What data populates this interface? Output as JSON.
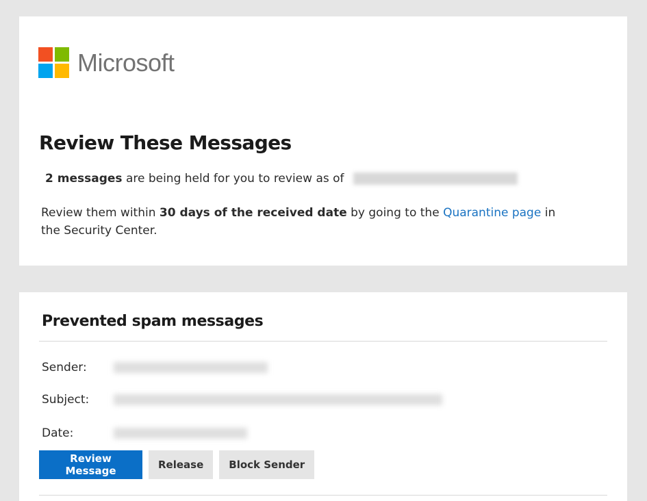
{
  "brand": {
    "name": "Microsoft",
    "logo_colors": [
      "#f25022",
      "#7fba00",
      "#00a4ef",
      "#ffb900"
    ]
  },
  "summary": {
    "title": "Review These Messages",
    "count_text": "2 messages",
    "held_text": "are being held for you to review as of",
    "review_prefix": "Review them within",
    "days_text": "30 days of the received date",
    "going_text": "by going to the",
    "link_text": "Quarantine page",
    "suffix_text": "in the Security Center."
  },
  "spam_section": {
    "title": "Prevented spam messages",
    "sender_label": "Sender:",
    "subject_label": "Subject:",
    "date_label": "Date:"
  },
  "actions": {
    "review_label": "Review Message",
    "release_label": "Release",
    "block_label": "Block Sender"
  },
  "colors": {
    "primary_button": "#0b6fc7",
    "link": "#1a73c2",
    "background": "#e6e6e6"
  }
}
